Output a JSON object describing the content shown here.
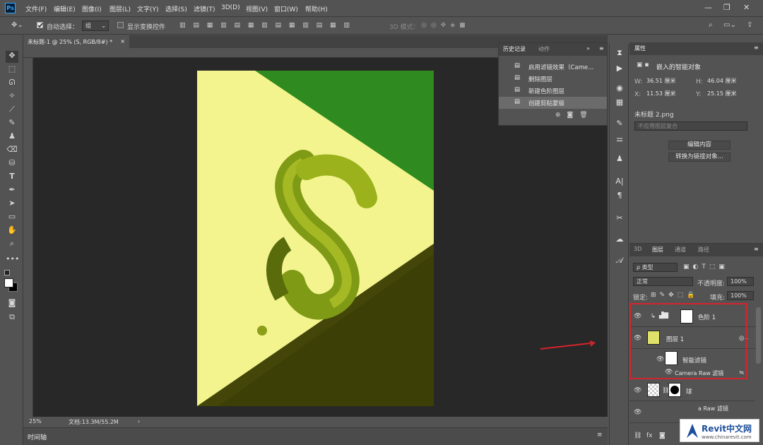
{
  "app": {
    "logo": "Ps"
  },
  "menu": [
    "文件(F)",
    "编辑(E)",
    "图像(I)",
    "图层(L)",
    "文字(Y)",
    "选择(S)",
    "滤镜(T)",
    "3D(D)",
    "视图(V)",
    "窗口(W)",
    "帮助(H)"
  ],
  "window_controls": {
    "minimize": "—",
    "maximize": "❐",
    "close": "✕"
  },
  "options": {
    "auto_select_label": "自动选择：",
    "auto_select_value": "组",
    "show_transform_label": "显示变换控件",
    "mode_3d": "3D 模式："
  },
  "document": {
    "tab_title": "未标题-1 @ 25% (S, RGB/8#) *",
    "zoom": "25%",
    "doc_size": "文档:13.3M/55.2M"
  },
  "timeline": {
    "label": "时间轴"
  },
  "history": {
    "tabs": [
      "历史记录",
      "动作"
    ],
    "items": [
      "启用滤镜效果（Came...",
      "删除图层",
      "新建色阶图层",
      "创建剪贴蒙版"
    ]
  },
  "properties": {
    "title": "属性",
    "type_label": "嵌入的智能对象",
    "w_label": "W:",
    "w_value": "36.51 厘米",
    "h_label": "H:",
    "h_value": "46.04 厘米",
    "x_label": "X:",
    "x_value": "11.53 厘米",
    "y_label": "Y:",
    "y_value": "25.15 厘米",
    "filename": "未标题 2.png",
    "comp_placeholder": "不应用图层复合",
    "edit_btn": "编辑内容",
    "convert_btn": "转换为链接对象..."
  },
  "layers_panel": {
    "tabs": [
      "3D",
      "图层",
      "通道",
      "路径"
    ],
    "filter_label": "ρ 类型",
    "blend_mode": "正常",
    "opacity_label": "不透明度:",
    "opacity_value": "100%",
    "lock_label": "锁定:",
    "fill_label": "填充:",
    "fill_value": "100%",
    "layers": [
      {
        "name": "色阶 1"
      },
      {
        "name": "图层 1"
      },
      {
        "name": "智能滤镜"
      },
      {
        "name": "Camera Raw 滤镜"
      },
      {
        "name": "球"
      },
      {
        "name": "a Raw 滤镜"
      }
    ]
  },
  "watermark": {
    "brand": "Revit中文网",
    "url": "www.chinarevit.com"
  },
  "colors": {
    "bg_green": "#2f8a1f",
    "yellow": "#f3f48e",
    "dark_olive": "#3c3f06",
    "ribbon": "#8aa10f",
    "annotation_red": "#d4242c"
  }
}
